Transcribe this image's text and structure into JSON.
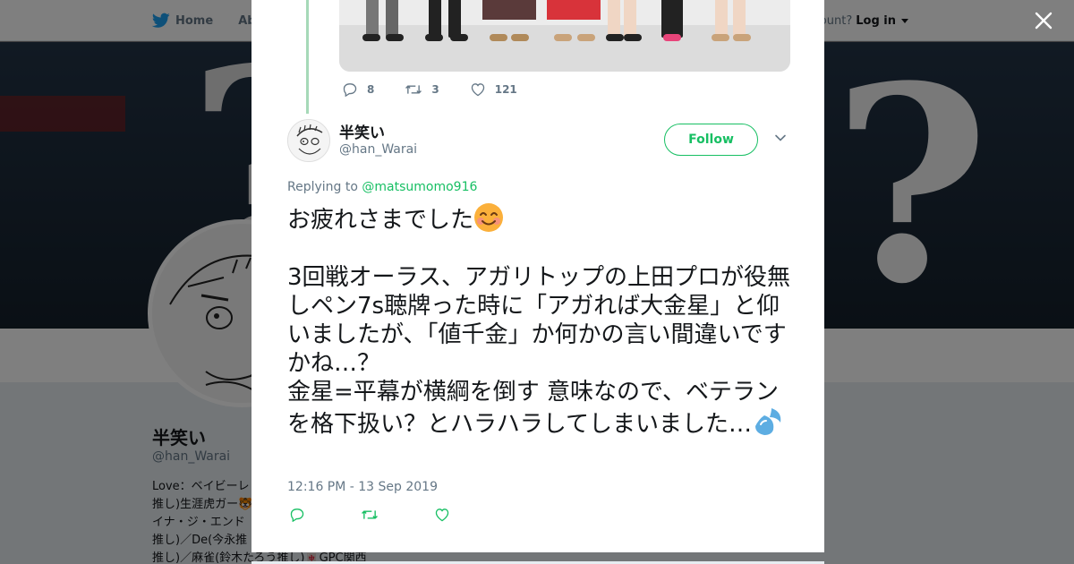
{
  "nav": {
    "home_label": "Home",
    "about_label": "Abo",
    "account_prompt": "ccount?",
    "login_label": "Log in"
  },
  "profile": {
    "name": "半笑い",
    "handle": "@han_Warai",
    "bio_lines": [
      "Love：ベイビーレ",
      "推し)生涯虎ガー🐯",
      "イナ・ジ・エンド",
      "推し)／De(今永推",
      "推し)／麻雀(鈴木たろう推し)🀄GPC関西"
    ]
  },
  "previous_tweet": {
    "replies": "8",
    "retweets": "3",
    "likes": "121"
  },
  "tweet": {
    "author_name": "半笑い",
    "author_handle": "@han_Warai",
    "follow_label": "Follow",
    "replying_prefix": "Replying to",
    "replying_to": "@matsumomo916",
    "text_line1": "お疲れさまでした",
    "text_para2_a": "3回戦オーラス、アガリトップの上田プロが役無しペン7s聴牌った時に「アガれば大金星」と仰いましたが、「値千金」か何かの言い間違いですかね…？",
    "text_para2_b": "金星=平幕が横綱を倒す 意味なので、ベテランを格下扱い？とハラハラしてしまいました…",
    "timestamp": "12:16 PM - 13 Sep 2019"
  },
  "icons": {
    "bird": "twitter-bird-icon",
    "close": "close-icon",
    "reply": "reply-icon",
    "retweet": "retweet-icon",
    "like": "heart-icon",
    "more": "chevron-down-icon",
    "emoji1": "smiling-face-icon",
    "emoji2": "sweat-droplets-icon"
  },
  "colors": {
    "accent": "#17bf63",
    "nav_bird": "#1da1f2",
    "text": "#14171a",
    "muted": "#657786"
  }
}
